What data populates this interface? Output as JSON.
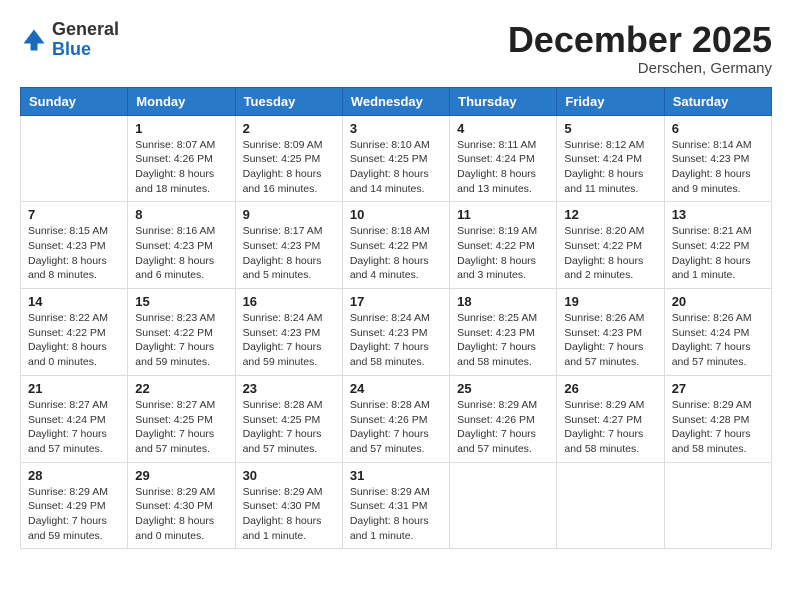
{
  "header": {
    "logo_general": "General",
    "logo_blue": "Blue",
    "month_title": "December 2025",
    "location": "Derschen, Germany"
  },
  "weekdays": [
    "Sunday",
    "Monday",
    "Tuesday",
    "Wednesday",
    "Thursday",
    "Friday",
    "Saturday"
  ],
  "weeks": [
    [
      {
        "day": "",
        "info": ""
      },
      {
        "day": "1",
        "info": "Sunrise: 8:07 AM\nSunset: 4:26 PM\nDaylight: 8 hours\nand 18 minutes."
      },
      {
        "day": "2",
        "info": "Sunrise: 8:09 AM\nSunset: 4:25 PM\nDaylight: 8 hours\nand 16 minutes."
      },
      {
        "day": "3",
        "info": "Sunrise: 8:10 AM\nSunset: 4:25 PM\nDaylight: 8 hours\nand 14 minutes."
      },
      {
        "day": "4",
        "info": "Sunrise: 8:11 AM\nSunset: 4:24 PM\nDaylight: 8 hours\nand 13 minutes."
      },
      {
        "day": "5",
        "info": "Sunrise: 8:12 AM\nSunset: 4:24 PM\nDaylight: 8 hours\nand 11 minutes."
      },
      {
        "day": "6",
        "info": "Sunrise: 8:14 AM\nSunset: 4:23 PM\nDaylight: 8 hours\nand 9 minutes."
      }
    ],
    [
      {
        "day": "7",
        "info": "Sunrise: 8:15 AM\nSunset: 4:23 PM\nDaylight: 8 hours\nand 8 minutes."
      },
      {
        "day": "8",
        "info": "Sunrise: 8:16 AM\nSunset: 4:23 PM\nDaylight: 8 hours\nand 6 minutes."
      },
      {
        "day": "9",
        "info": "Sunrise: 8:17 AM\nSunset: 4:23 PM\nDaylight: 8 hours\nand 5 minutes."
      },
      {
        "day": "10",
        "info": "Sunrise: 8:18 AM\nSunset: 4:22 PM\nDaylight: 8 hours\nand 4 minutes."
      },
      {
        "day": "11",
        "info": "Sunrise: 8:19 AM\nSunset: 4:22 PM\nDaylight: 8 hours\nand 3 minutes."
      },
      {
        "day": "12",
        "info": "Sunrise: 8:20 AM\nSunset: 4:22 PM\nDaylight: 8 hours\nand 2 minutes."
      },
      {
        "day": "13",
        "info": "Sunrise: 8:21 AM\nSunset: 4:22 PM\nDaylight: 8 hours\nand 1 minute."
      }
    ],
    [
      {
        "day": "14",
        "info": "Sunrise: 8:22 AM\nSunset: 4:22 PM\nDaylight: 8 hours\nand 0 minutes."
      },
      {
        "day": "15",
        "info": "Sunrise: 8:23 AM\nSunset: 4:22 PM\nDaylight: 7 hours\nand 59 minutes."
      },
      {
        "day": "16",
        "info": "Sunrise: 8:24 AM\nSunset: 4:23 PM\nDaylight: 7 hours\nand 59 minutes."
      },
      {
        "day": "17",
        "info": "Sunrise: 8:24 AM\nSunset: 4:23 PM\nDaylight: 7 hours\nand 58 minutes."
      },
      {
        "day": "18",
        "info": "Sunrise: 8:25 AM\nSunset: 4:23 PM\nDaylight: 7 hours\nand 58 minutes."
      },
      {
        "day": "19",
        "info": "Sunrise: 8:26 AM\nSunset: 4:23 PM\nDaylight: 7 hours\nand 57 minutes."
      },
      {
        "day": "20",
        "info": "Sunrise: 8:26 AM\nSunset: 4:24 PM\nDaylight: 7 hours\nand 57 minutes."
      }
    ],
    [
      {
        "day": "21",
        "info": "Sunrise: 8:27 AM\nSunset: 4:24 PM\nDaylight: 7 hours\nand 57 minutes."
      },
      {
        "day": "22",
        "info": "Sunrise: 8:27 AM\nSunset: 4:25 PM\nDaylight: 7 hours\nand 57 minutes."
      },
      {
        "day": "23",
        "info": "Sunrise: 8:28 AM\nSunset: 4:25 PM\nDaylight: 7 hours\nand 57 minutes."
      },
      {
        "day": "24",
        "info": "Sunrise: 8:28 AM\nSunset: 4:26 PM\nDaylight: 7 hours\nand 57 minutes."
      },
      {
        "day": "25",
        "info": "Sunrise: 8:29 AM\nSunset: 4:26 PM\nDaylight: 7 hours\nand 57 minutes."
      },
      {
        "day": "26",
        "info": "Sunrise: 8:29 AM\nSunset: 4:27 PM\nDaylight: 7 hours\nand 58 minutes."
      },
      {
        "day": "27",
        "info": "Sunrise: 8:29 AM\nSunset: 4:28 PM\nDaylight: 7 hours\nand 58 minutes."
      }
    ],
    [
      {
        "day": "28",
        "info": "Sunrise: 8:29 AM\nSunset: 4:29 PM\nDaylight: 7 hours\nand 59 minutes."
      },
      {
        "day": "29",
        "info": "Sunrise: 8:29 AM\nSunset: 4:30 PM\nDaylight: 8 hours\nand 0 minutes."
      },
      {
        "day": "30",
        "info": "Sunrise: 8:29 AM\nSunset: 4:30 PM\nDaylight: 8 hours\nand 1 minute."
      },
      {
        "day": "31",
        "info": "Sunrise: 8:29 AM\nSunset: 4:31 PM\nDaylight: 8 hours\nand 1 minute."
      },
      {
        "day": "",
        "info": ""
      },
      {
        "day": "",
        "info": ""
      },
      {
        "day": "",
        "info": ""
      }
    ]
  ]
}
